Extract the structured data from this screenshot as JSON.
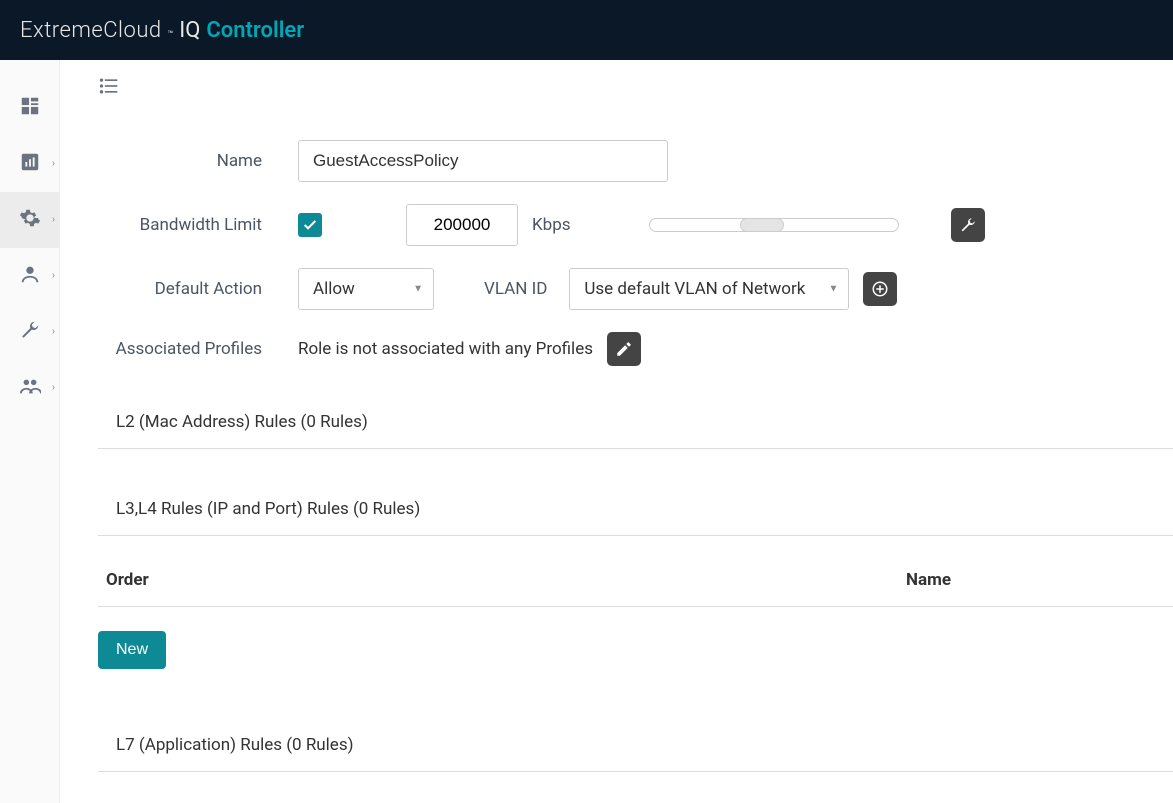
{
  "header": {
    "logo_part1": "ExtremeCloud",
    "logo_tm": "™",
    "logo_part2": "IQ",
    "logo_part3": "Controller"
  },
  "sidebar": {
    "items": [
      {
        "icon": "dashboard"
      },
      {
        "icon": "chart"
      },
      {
        "icon": "gear"
      },
      {
        "icon": "user"
      },
      {
        "icon": "wrench"
      },
      {
        "icon": "users"
      }
    ]
  },
  "form": {
    "name_label": "Name",
    "name_value": "GuestAccessPolicy",
    "bw_label": "Bandwidth Limit",
    "bw_checked": true,
    "bw_value": "200000",
    "bw_unit": "Kbps",
    "default_action_label": "Default Action",
    "default_action_value": "Allow",
    "vlan_label": "VLAN ID",
    "vlan_value": "Use default VLAN of Network",
    "assoc_label": "Associated Profiles",
    "assoc_text": "Role is not associated with any Profiles"
  },
  "sections": {
    "l2": "L2 (Mac Address) Rules (0 Rules)",
    "l34": "L3,L4 Rules (IP and Port) Rules (0 Rules)",
    "l7": "L7 (Application) Rules (0 Rules)"
  },
  "table": {
    "col_order": "Order",
    "col_name": "Name"
  },
  "buttons": {
    "new": "New"
  }
}
